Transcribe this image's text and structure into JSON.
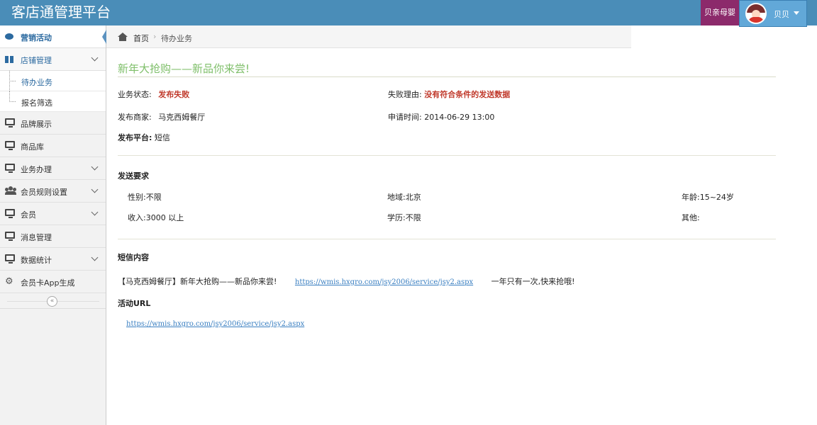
{
  "app": {
    "title": "客店通管理平台"
  },
  "header": {
    "shop_label": "贝亲母婴",
    "user_name": "贝贝"
  },
  "sidebar": {
    "items": [
      {
        "label": "营销活动"
      },
      {
        "label": "店铺管理"
      },
      {
        "label": "品牌展示"
      },
      {
        "label": "商品库"
      },
      {
        "label": "业务办理"
      },
      {
        "label": "会员规则设置"
      },
      {
        "label": "会员"
      },
      {
        "label": "消息管理"
      },
      {
        "label": "数据统计"
      },
      {
        "label": "会员卡App生成"
      }
    ],
    "sub_items": [
      {
        "label": "待办业务"
      },
      {
        "label": "报名筛选"
      }
    ],
    "collapse_glyph": "«"
  },
  "breadcrumb": {
    "home": "首页",
    "separator": "›",
    "current": "待办业务"
  },
  "main": {
    "title": "新年大抢购——新品你来尝!",
    "status_label": "业务状态:",
    "status_value": "发布失败",
    "fail_reason_label": "失败理由:",
    "fail_reason_value": "没有符合条件的发送数据",
    "merchant_label": "发布商家:",
    "merchant_value": "马克西姆餐厅",
    "apply_time_label": "申请时间:",
    "apply_time_value": "2014-06-29 13:00",
    "platform_label": "发布平台:",
    "platform_value": "短信",
    "requirements_heading": "发送要求",
    "gender": "性别:不限",
    "region": "地域:北京",
    "age": "年龄:15~24岁",
    "income": "收入:3000 以上",
    "education": "学历:不限",
    "other": "其他:",
    "sms_heading": "短信内容",
    "sms_prefix": "【马克西姆餐厅】新年大抢购——新品你来尝!",
    "sms_link": "https://wmis.hxgro.com/jsy2006/service/jsy2.aspx",
    "sms_suffix": "一年只有一次,快来抢哦!",
    "url_heading": "活动URL",
    "url_link": "https://wmis.hxgro.com/jsy2006/service/jsy2.aspx"
  }
}
